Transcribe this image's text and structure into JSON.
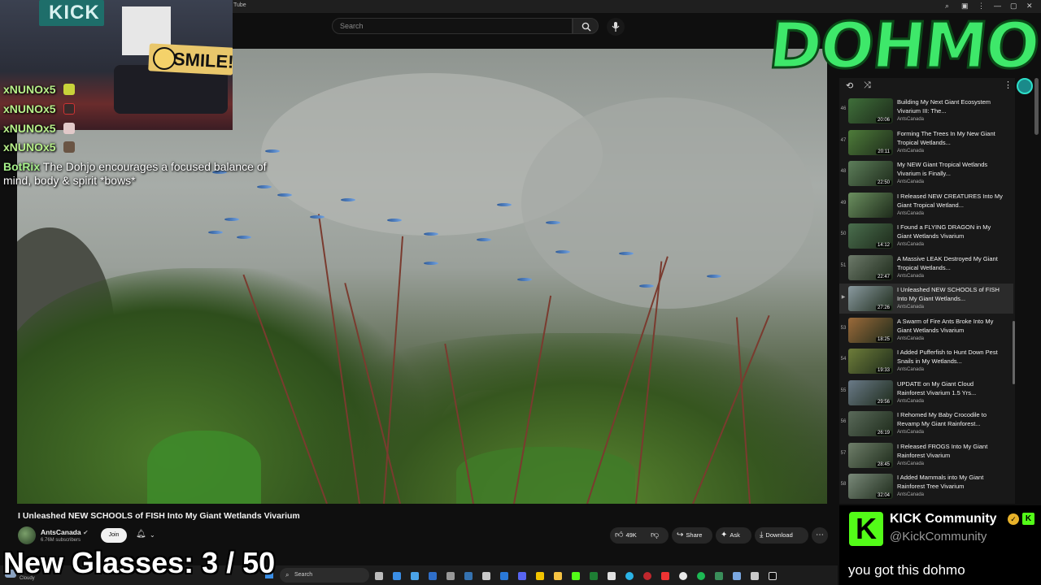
{
  "window": {
    "title": "Tube"
  },
  "youtube": {
    "search_placeholder": "Search",
    "video_title": "I Unleashed NEW SCHOOLS of FISH Into My Giant Wetlands Vivarium",
    "channel": {
      "name": "AntsCanada",
      "subscribers": "6.76M subscribers"
    },
    "join_label": "Join",
    "actions": {
      "likes": "49K",
      "share": "Share",
      "ask": "Ask",
      "download": "Download"
    }
  },
  "playlist": {
    "items": [
      {
        "index": "46",
        "title": "Building My Next Giant Ecosystem Vivarium III: The...",
        "channel": "AntsCanada",
        "duration": "20:06",
        "current": false
      },
      {
        "index": "47",
        "title": "Forming The Trees In My New Giant Tropical Wetlands...",
        "channel": "AntsCanada",
        "duration": "20:11",
        "current": false
      },
      {
        "index": "48",
        "title": "My NEW Giant Tropical Wetlands Vivarium is Finally...",
        "channel": "AntsCanada",
        "duration": "22:50",
        "current": false
      },
      {
        "index": "49",
        "title": "I Released NEW CREATURES Into My Giant Tropical Wetland...",
        "channel": "AntsCanada",
        "duration": "",
        "current": false
      },
      {
        "index": "50",
        "title": "I Found a FLYING DRAGON in My Giant Wetlands Vivarium",
        "channel": "AntsCanada",
        "duration": "14:12",
        "current": false
      },
      {
        "index": "51",
        "title": "A Massive LEAK Destroyed My Giant Tropical Wetlands...",
        "channel": "AntsCanada",
        "duration": "22:47",
        "current": false
      },
      {
        "index": "▶",
        "title": "I Unleashed NEW SCHOOLS of FISH Into My Giant Wetlands...",
        "channel": "AntsCanada",
        "duration": "27:26",
        "current": true
      },
      {
        "index": "53",
        "title": "A Swarm of Fire Ants Broke Into My Giant Wetlands Vivarium",
        "channel": "AntsCanada",
        "duration": "18:25",
        "current": false
      },
      {
        "index": "54",
        "title": "I Added Pufferfish to Hunt Down Pest Snails in My Wetlands...",
        "channel": "AntsCanada",
        "duration": "19:33",
        "current": false
      },
      {
        "index": "55",
        "title": "UPDATE on My Giant Cloud Rainforest Vivarium 1.5 Yrs...",
        "channel": "AntsCanada",
        "duration": "29:56",
        "current": false
      },
      {
        "index": "56",
        "title": "I Rehomed My Baby Crocodile to Revamp My Giant Rainforest...",
        "channel": "AntsCanada",
        "duration": "26:19",
        "current": false
      },
      {
        "index": "57",
        "title": "I Released FROGS Into My Giant Rainforest Vivarium",
        "channel": "AntsCanada",
        "duration": "28:45",
        "current": false
      },
      {
        "index": "58",
        "title": "I Added Mammals into My Giant Rainforest Tree Vivarium",
        "channel": "AntsCanada",
        "duration": "32:04",
        "current": false
      }
    ]
  },
  "stream": {
    "chat": [
      {
        "user": "xNUNOx5"
      },
      {
        "user": "xNUNOx5"
      },
      {
        "user": "xNUNOx5"
      },
      {
        "user": "xNUNOx5"
      }
    ],
    "bot": {
      "name": "BotRix",
      "message": "The Dohjo encourages a focused balance of mind, body & spirit *bows*"
    },
    "webcam": {
      "sign_kick": "KICK",
      "sign_smile": "SMILE!"
    },
    "logo_text": "DOHMO",
    "counter": "New Glasses:  3 / 50",
    "kick_panel": {
      "name": "KICK Community",
      "handle": "@KickCommunity",
      "message": "you got this dohmo"
    }
  },
  "taskbar": {
    "weather": "Cloudy",
    "search_placeholder": "Search"
  },
  "colors": {
    "accent_green": "#53fc18",
    "dohmo_green": "#3ee86a",
    "yt_bg": "#0f0f0f"
  }
}
